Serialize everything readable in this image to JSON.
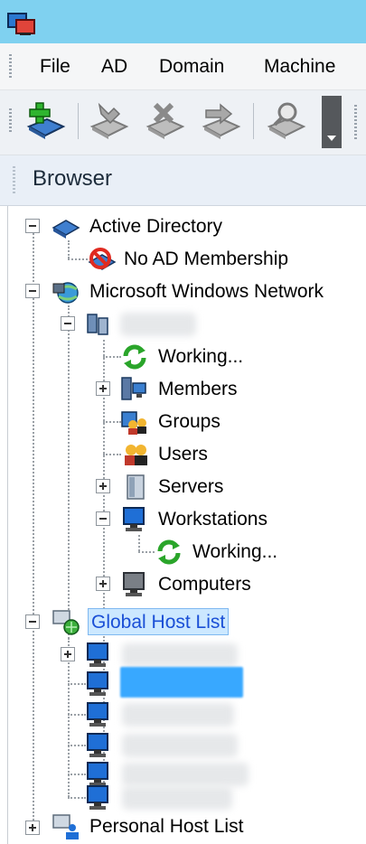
{
  "menu": [
    "File",
    "AD",
    "Domain",
    "Machine"
  ],
  "toolbar": {
    "icons": [
      "add-book-icon",
      "wrench-book-icon",
      "delete-book-icon",
      "move-book-icon",
      "search-book-icon"
    ]
  },
  "browser": {
    "title": "Browser"
  },
  "tree": {
    "active_directory": "Active Directory",
    "no_ad": "No AD Membership",
    "ms_network": "Microsoft Windows Network",
    "working_1": "Working...",
    "members": "Members",
    "groups": "Groups",
    "users": "Users",
    "servers": "Servers",
    "workstations": "Workstations",
    "working_2": "Working...",
    "computers": "Computers",
    "global_host_list": "Global Host List",
    "personal_host_list": "Personal Host List"
  },
  "colors": {
    "titlebar": "#7fd1f0",
    "selection": "#cce8ff",
    "selection_text": "#1a4fd6"
  }
}
